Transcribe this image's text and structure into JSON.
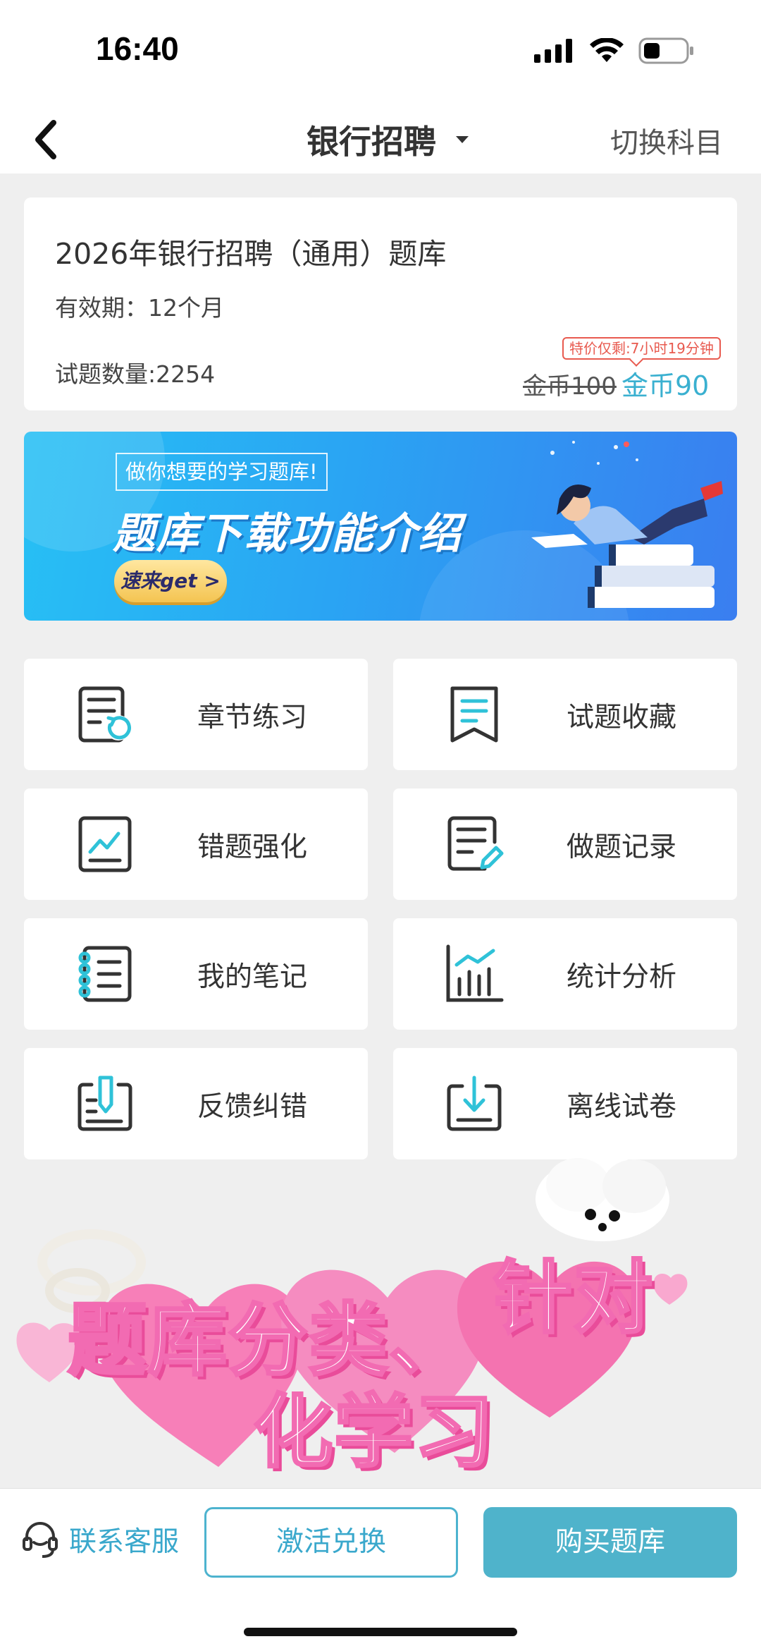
{
  "status_bar": {
    "time": "16:40"
  },
  "nav": {
    "title": "银行招聘",
    "switch_label": "切换科目"
  },
  "info": {
    "title": "2026年银行招聘（通用）题库",
    "validity": "有效期：12个月",
    "question_count": "试题数量:2254",
    "promo_badge": "特价仅剩:7小时19分钟",
    "old_price": "金币100",
    "new_price": "金币90"
  },
  "banner": {
    "tag": "做你想要的学习题库!",
    "headline": "题库下载功能介绍",
    "cta": "速来get >"
  },
  "features": [
    {
      "label": "章节练习",
      "icon": "chapter-practice-icon"
    },
    {
      "label": "试题收藏",
      "icon": "bookmark-icon"
    },
    {
      "label": "错题强化",
      "icon": "wrong-question-chart-icon"
    },
    {
      "label": "做题记录",
      "icon": "record-edit-icon"
    },
    {
      "label": "我的笔记",
      "icon": "notebook-icon"
    },
    {
      "label": "统计分析",
      "icon": "statistics-bar-chart-icon"
    },
    {
      "label": "反馈纠错",
      "icon": "feedback-icon"
    },
    {
      "label": "离线试卷",
      "icon": "download-icon"
    }
  ],
  "decoration": {
    "line1": "题库分类、",
    "line2": "针对",
    "line3": "化学习"
  },
  "bottom": {
    "support_label": "联系客服",
    "activate_label": "激活兑换",
    "buy_label": "购买题库"
  },
  "colors": {
    "accent": "#4fb3cb",
    "icon_teal": "#2fc2d8",
    "promo_red": "#e85a4f",
    "deco_pink": "#f26bb2"
  }
}
